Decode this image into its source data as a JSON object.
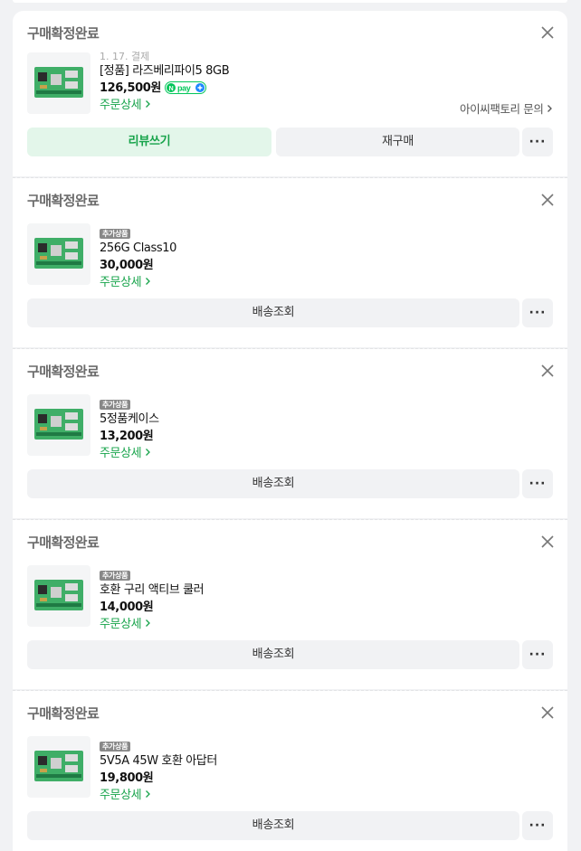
{
  "orders": [
    {
      "status": "구매확정완료",
      "date": "1. 17. 결제",
      "badge": "",
      "name": "[정품] 라즈베리파이5 8GB",
      "price": "126,500원",
      "npay": "N pay +",
      "detail_label": "주문상세",
      "seller": "아이씨팩토리 문의",
      "buttons": [
        "리뷰쓰기",
        "재구매"
      ],
      "more_label": "···"
    },
    {
      "status": "구매확정완료",
      "badge": "추가상품",
      "name": "256G Class10",
      "price": "30,000원",
      "detail_label": "주문상세",
      "buttons": [
        "배송조회"
      ],
      "more_label": "···"
    },
    {
      "status": "구매확정완료",
      "badge": "추가상품",
      "name": "5정품케이스",
      "price": "13,200원",
      "detail_label": "주문상세",
      "buttons": [
        "배송조회"
      ],
      "more_label": "···"
    },
    {
      "status": "구매확정완료",
      "badge": "추가상품",
      "name": "호환 구리 액티브 쿨러",
      "price": "14,000원",
      "detail_label": "주문상세",
      "buttons": [
        "배송조회"
      ],
      "more_label": "···"
    },
    {
      "status": "구매확정완료",
      "badge": "추가상품",
      "name": "5V5A 45W 호환 아답터",
      "price": "19,800원",
      "detail_label": "주문상세",
      "buttons": [
        "배송조회"
      ],
      "more_label": "···"
    }
  ],
  "colors": {
    "accent_green": "#16a34a",
    "review_bg": "#e3f6ea",
    "npay_green": "#03c75a",
    "npay_blue": "#1e88ff"
  },
  "icons": {
    "close": "close-icon",
    "chevron": "chevron-right-icon",
    "more": "more-icon",
    "thumb": "raspberry-pi-board-image"
  }
}
